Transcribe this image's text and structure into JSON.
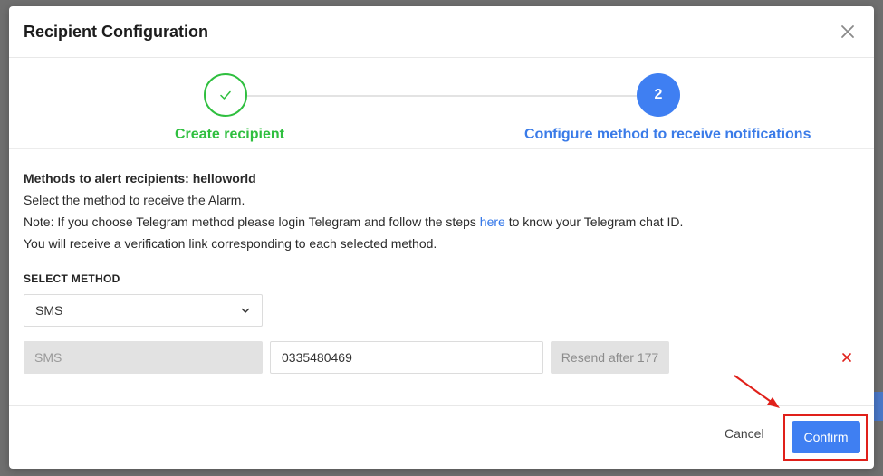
{
  "modal": {
    "title": "Recipient Configuration"
  },
  "stepper": {
    "steps": [
      {
        "number": "1",
        "label": "Create recipient",
        "status": "completed"
      },
      {
        "number": "2",
        "label": "Configure method to receive notifications",
        "status": "active"
      }
    ]
  },
  "info": {
    "title": "Methods to alert recipients: helloworld",
    "line1": "Select the method to receive the Alarm.",
    "note_prefix": "Note: If you choose Telegram method please login Telegram and follow the steps ",
    "note_link": "here",
    "note_suffix": " to know your Telegram chat ID.",
    "line3": "You will receive a verification link corresponding to each selected method."
  },
  "select_method": {
    "label": "SELECT METHOD",
    "selected": "SMS"
  },
  "method_row": {
    "method": "SMS",
    "phone_value": "0335480469",
    "resend_label": "Resend after 177"
  },
  "footer": {
    "cancel_label": "Cancel",
    "confirm_label": "Confirm"
  },
  "colors": {
    "success": "#2fbf3f",
    "primary": "#3f7ff2",
    "danger": "#e0201a"
  },
  "icons": {
    "close": "close-icon",
    "check": "check-icon",
    "dropdown": "chevron-down-icon",
    "remove": "remove-icon"
  }
}
